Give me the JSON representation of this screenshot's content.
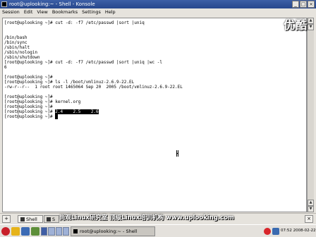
{
  "window": {
    "title": "root@uplooking:~ - Shell - Konsole",
    "minimize": "_",
    "maximize": "□",
    "close": "×"
  },
  "watermark": "优酷",
  "menu": [
    "Session",
    "Edit",
    "View",
    "Bookmarks",
    "Settings",
    "Help"
  ],
  "terminal": {
    "lines": [
      "[root@uplooking ~]# cut -d: -f7 /etc/passwd |sort |uniq",
      "",
      "/bin/bash",
      "/bin/sync",
      "/sbin/halt",
      "/sbin/nologin",
      "/sbin/shutdown",
      "[root@uplooking ~]# cut -d: -f7 /etc/passwd |sort |uniq |wc -l",
      "6",
      "[root@uplooking ~]#",
      "[root@uplooking ~]# ls -l /boot/vmlinuz-2.6.9-22.EL",
      "-rw-r--r--  1 root root 1465064 Sep 20  2005 /boot/vmlinuz-2.6.9-22.EL",
      "[root@uplooking ~]#",
      "[root@uplooking ~]# kernel.org",
      "[root@uplooking ~]# "
    ],
    "selected_prompt": "[root@uplooking ~]# ",
    "selected_text": "2.4    2.5    2.6",
    "last_prompt": "[root@uplooking ~]# "
  },
  "tabs": {
    "new_tab": "+",
    "tab1_label": "Shell",
    "tab2_label": "S",
    "close_tab": "×"
  },
  "banner": "尚观Linux研究室  顶级Linux培训机构  www.uplooking.com",
  "taskbar": {
    "task_label": "root@uplooking:~ - Shell",
    "clock": "07:52  2008-02-22"
  }
}
